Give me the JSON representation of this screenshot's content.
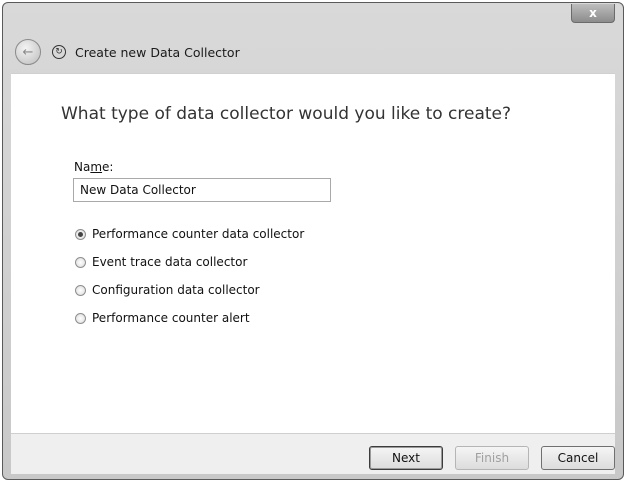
{
  "window": {
    "title": "Create new Data Collector",
    "close_glyph": "x"
  },
  "content": {
    "heading": "What type of data collector would you like to create?",
    "name_label": "Name:",
    "name_value": "New Data Collector",
    "radio_options": [
      {
        "label": "Performance counter data collector",
        "checked": true
      },
      {
        "label": "Event trace data collector",
        "checked": false
      },
      {
        "label": "Configuration data collector",
        "checked": false
      },
      {
        "label": "Performance counter alert",
        "checked": false
      }
    ]
  },
  "footer": {
    "next_label": "Next",
    "finish_label": "Finish",
    "cancel_label": "Cancel"
  },
  "icons": {
    "back": "back-arrow-icon",
    "app": "data-collector-icon",
    "close": "close-icon"
  }
}
